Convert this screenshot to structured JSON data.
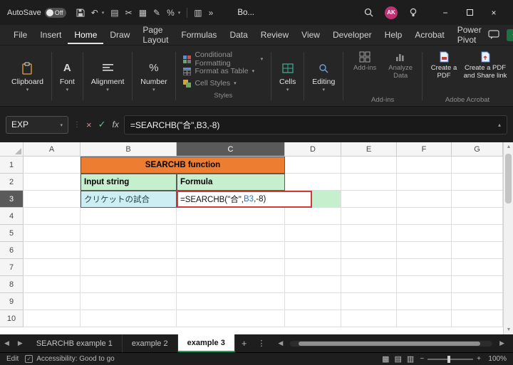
{
  "colors": {
    "accent_green": "#1E9E62",
    "orange_fill": "#ED7D31",
    "green_fill": "#C6EFCE",
    "cyan_fill": "#CDEEF3",
    "edit_border_red": "#D03A3A",
    "reference_blue": "#2E75B6",
    "avatar_bg": "#BF3073"
  },
  "titlebar": {
    "autosave_label": "AutoSave",
    "autosave_state": "Off",
    "doc_title": "Bo...",
    "avatar": "AK"
  },
  "menubar": {
    "items": [
      "File",
      "Insert",
      "Home",
      "Draw",
      "Page Layout",
      "Formulas",
      "Data",
      "Review",
      "View",
      "Developer",
      "Help",
      "Acrobat",
      "Power Pivot"
    ],
    "active_item": "Home"
  },
  "ribbon": {
    "collapsed": [
      {
        "label": "Clipboard"
      },
      {
        "label": "Font"
      },
      {
        "label": "Alignment"
      },
      {
        "label": "Number"
      }
    ],
    "styles": {
      "items": [
        "Conditional Formatting",
        "Format as Table",
        "Cell Styles"
      ],
      "group_label": "Styles"
    },
    "cells_label": "Cells",
    "editing_label": "Editing",
    "addins": {
      "buttons": [
        "Add-ins",
        "Analyze Data"
      ],
      "group_label": "Add-ins"
    },
    "acrobat": {
      "buttons": [
        "Create a PDF",
        "Create a PDF and Share link"
      ],
      "group_label": "Adobe Acrobat"
    }
  },
  "formula_bar": {
    "name_box": "EXP",
    "fx_label": "fx",
    "formula": "=SEARCHB(\"合\",B3,-8)"
  },
  "grid": {
    "columns": [
      "A",
      "B",
      "C",
      "D",
      "E",
      "F",
      "G"
    ],
    "rows": [
      "1",
      "2",
      "3",
      "4",
      "5",
      "6",
      "7",
      "8",
      "9",
      "10"
    ],
    "title_cell": "SEARCHB function",
    "header_input": "Input string",
    "header_formula": "Formula",
    "input_value": "クリケットの試合",
    "edit_formula": {
      "prefix": "=SEARCHB(\"合\",",
      "ref": "B3",
      "suffix": ",-8)"
    }
  },
  "sheet_tabs": {
    "tabs": [
      {
        "label": "SEARCHB example 1"
      },
      {
        "label": "example 2"
      },
      {
        "label": "example 3"
      }
    ],
    "active": "example 3"
  },
  "status_bar": {
    "mode": "Edit",
    "accessibility": "Accessibility: Good to go",
    "zoom": "100%"
  }
}
